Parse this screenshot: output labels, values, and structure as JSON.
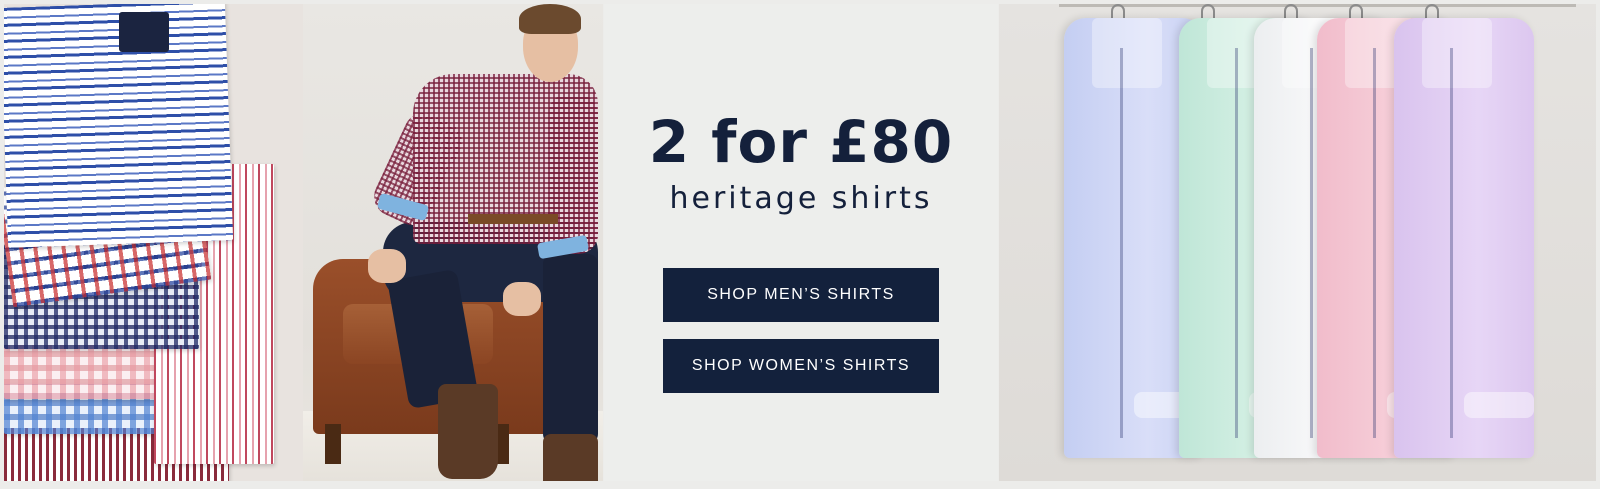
{
  "promo": {
    "headline": "2 for £80",
    "subheadline": "heritage shirts"
  },
  "ctas": {
    "men_label": "SHOP MEN’S SHIRTS",
    "women_label": "SHOP WOMEN’S SHIRTS"
  },
  "colors": {
    "navy": "#13213c",
    "panel_background": "#edeeec",
    "button_text": "#ffffff"
  },
  "images": {
    "folded_shirts": "folded striped and checked shirts",
    "model": "man in gingham shirt sitting on leather armchair",
    "hanging_shirts": "pastel oxford shirts on hangers"
  }
}
